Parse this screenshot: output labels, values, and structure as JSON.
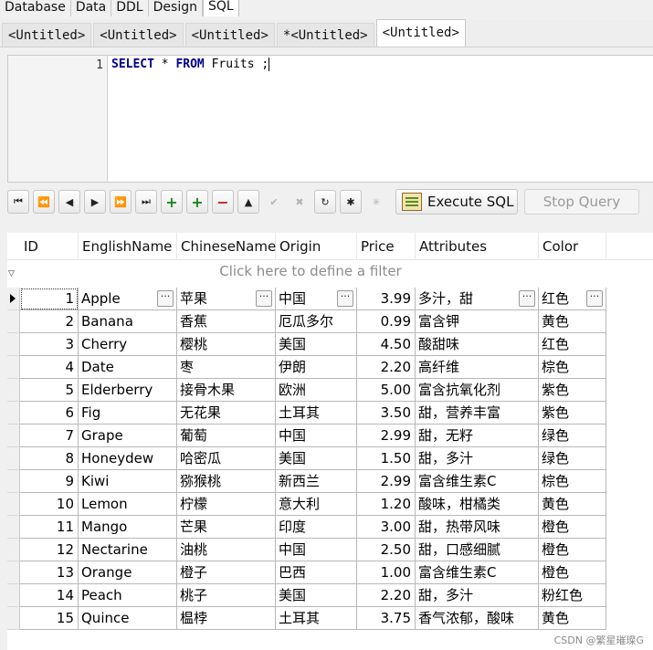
{
  "top_tabs": [
    "Database",
    "Data",
    "DDL",
    "Design",
    "SQL"
  ],
  "doc_tabs": [
    "<Untitled>",
    "<Untitled>",
    "<Untitled>",
    "*<Untitled>",
    "<Untitled>"
  ],
  "editor": {
    "line_number": "1",
    "kw_select": "SELECT",
    "star": " * ",
    "kw_from": "FROM",
    "rest": " Fruits ;"
  },
  "toolbar": {
    "execute_label": "Execute SQL",
    "stop_label": "Stop Query",
    "nav_icons": [
      "first-icon",
      "prev-page-icon",
      "prev-icon",
      "next-icon",
      "next-page-icon",
      "last-icon",
      "insert-icon",
      "append-icon",
      "delete-icon",
      "edit-icon",
      "post-icon",
      "cancel-icon",
      "refresh-icon",
      "snowflake-icon",
      "clear-icon"
    ]
  },
  "grid": {
    "columns": [
      "ID",
      "EnglishName",
      "ChineseName",
      "Origin",
      "Price",
      "Attributes",
      "Color"
    ],
    "filter_hint": "Click here to define a filter",
    "rows": [
      [
        "1",
        "Apple",
        "苹果",
        "中国",
        "3.99",
        "多汁，甜",
        "红色"
      ],
      [
        "2",
        "Banana",
        "香蕉",
        "厄瓜多尔",
        "0.99",
        "富含钾",
        "黄色"
      ],
      [
        "3",
        "Cherry",
        "樱桃",
        "美国",
        "4.50",
        "酸甜味",
        "红色"
      ],
      [
        "4",
        "Date",
        "枣",
        "伊朗",
        "2.20",
        "高纤维",
        "棕色"
      ],
      [
        "5",
        "Elderberry",
        "接骨木果",
        "欧洲",
        "5.00",
        "富含抗氧化剂",
        "紫色"
      ],
      [
        "6",
        "Fig",
        "无花果",
        "土耳其",
        "3.50",
        "甜，营养丰富",
        "紫色"
      ],
      [
        "7",
        "Grape",
        "葡萄",
        "中国",
        "2.99",
        "甜，无籽",
        "绿色"
      ],
      [
        "8",
        "Honeydew",
        "哈密瓜",
        "美国",
        "1.50",
        "甜，多汁",
        "绿色"
      ],
      [
        "9",
        "Kiwi",
        "猕猴桃",
        "新西兰",
        "2.99",
        "富含维生素C",
        "棕色"
      ],
      [
        "10",
        "Lemon",
        "柠檬",
        "意大利",
        "1.20",
        "酸味，柑橘类",
        "黄色"
      ],
      [
        "11",
        "Mango",
        "芒果",
        "印度",
        "3.00",
        "甜，热带风味",
        "橙色"
      ],
      [
        "12",
        "Nectarine",
        "油桃",
        "中国",
        "2.50",
        "甜，口感细腻",
        "橙色"
      ],
      [
        "13",
        "Orange",
        "橙子",
        "巴西",
        "1.00",
        "富含维生素C",
        "橙色"
      ],
      [
        "14",
        "Peach",
        "桃子",
        "美国",
        "2.20",
        "甜，多汁",
        "粉红色"
      ],
      [
        "15",
        "Quince",
        "榅桲",
        "土耳其",
        "3.75",
        "香气浓郁，酸味",
        "黄色"
      ]
    ]
  },
  "watermark": "CSDN @繁星璀璨G"
}
